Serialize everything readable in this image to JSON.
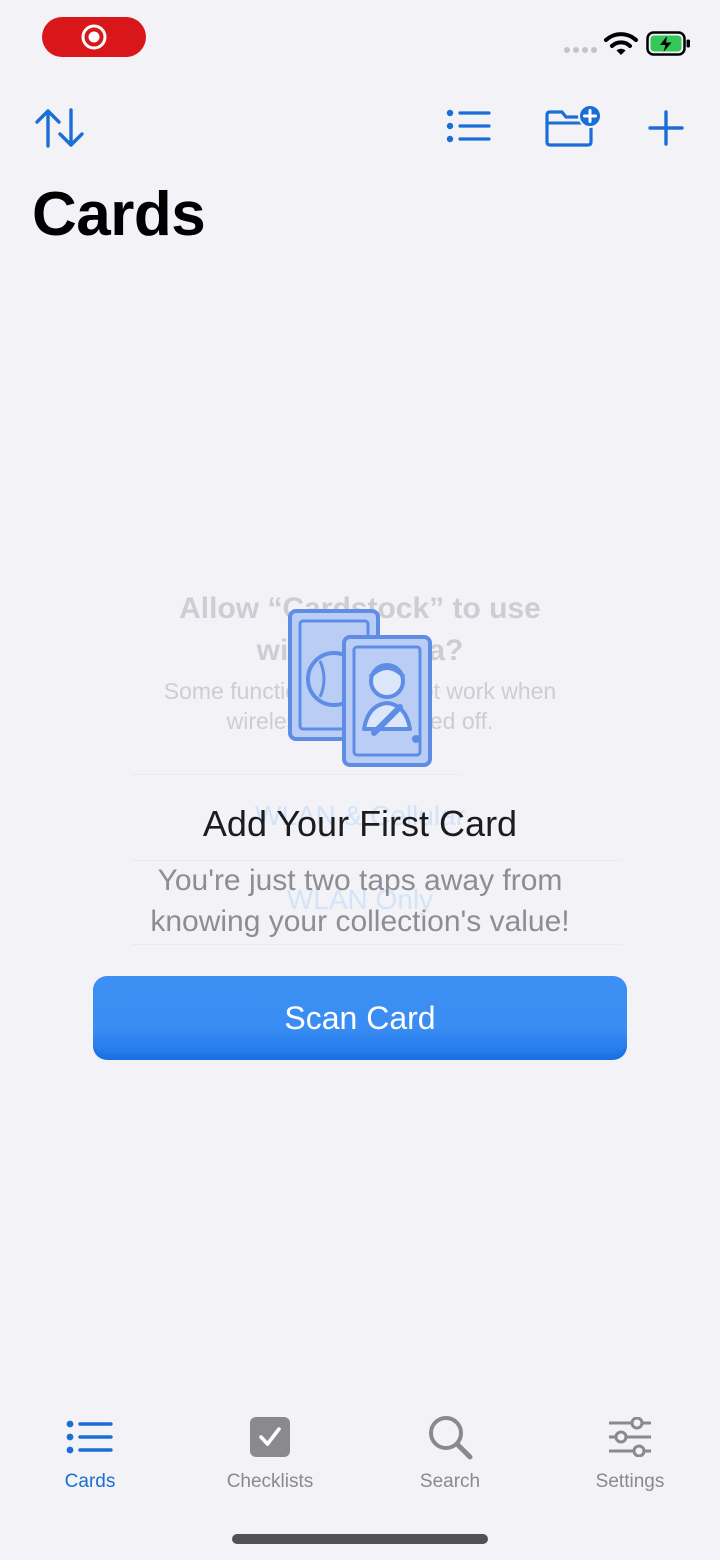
{
  "status_bar": {
    "recording_icon": "screen-record-icon",
    "wifi_icon": "wifi-icon",
    "battery_icon": "battery-charging-icon"
  },
  "nav": {
    "sort_icon": "sort-arrows-icon",
    "list_icon": "list-view-icon",
    "new_folder_icon": "folder-add-icon",
    "add_icon": "plus-icon",
    "title": "Cards"
  },
  "alert_overlay": {
    "title": "Allow “Cardstock” to use wireless data?",
    "message": "Some functionality may not work when wireless data is turned off.",
    "option_1": "WLAN & Cellular",
    "option_2": "WLAN Only"
  },
  "empty_state": {
    "illustration_icon": "trading-cards-icon",
    "title": "Add Your First Card",
    "subtitle": "You're just two taps away from knowing your collection's value!",
    "scan_button": "Scan Card"
  },
  "tabs": [
    {
      "label": "Cards",
      "icon": "list-icon",
      "active": true
    },
    {
      "label": "Checklists",
      "icon": "checkbox-icon",
      "active": false
    },
    {
      "label": "Search",
      "icon": "search-icon",
      "active": false
    },
    {
      "label": "Settings",
      "icon": "sliders-icon",
      "active": false
    }
  ],
  "colors": {
    "accent": "#1a6fd6",
    "button": "#2b83ef",
    "background": "#f3f2f7",
    "record": "#d9171b",
    "battery": "#34c759"
  }
}
